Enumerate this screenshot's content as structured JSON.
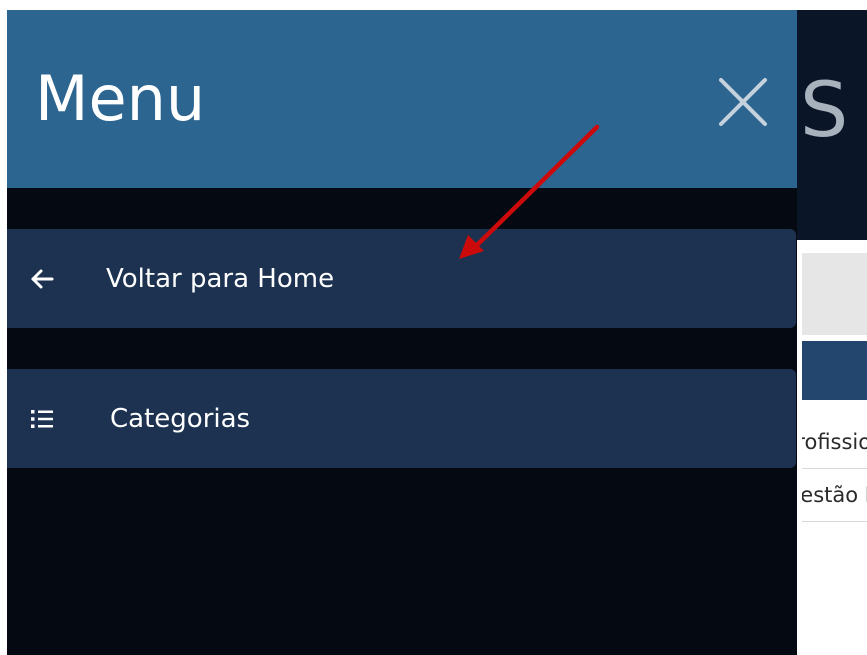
{
  "drawer": {
    "title": "Menu",
    "close_icon": "close-icon",
    "items": [
      {
        "label": "Voltar para Home",
        "icon": "arrow-left-icon"
      },
      {
        "label": "Categorias",
        "icon": "list-icon"
      }
    ],
    "colors": {
      "header": "#2d6591",
      "background": "#050a12",
      "item": "#1c3250"
    }
  },
  "background_page": {
    "title_fragment": "S",
    "rows": [
      "Profissio",
      "Gestão Ef"
    ]
  },
  "annotation": {
    "arrow_color": "#cc0a0a"
  }
}
